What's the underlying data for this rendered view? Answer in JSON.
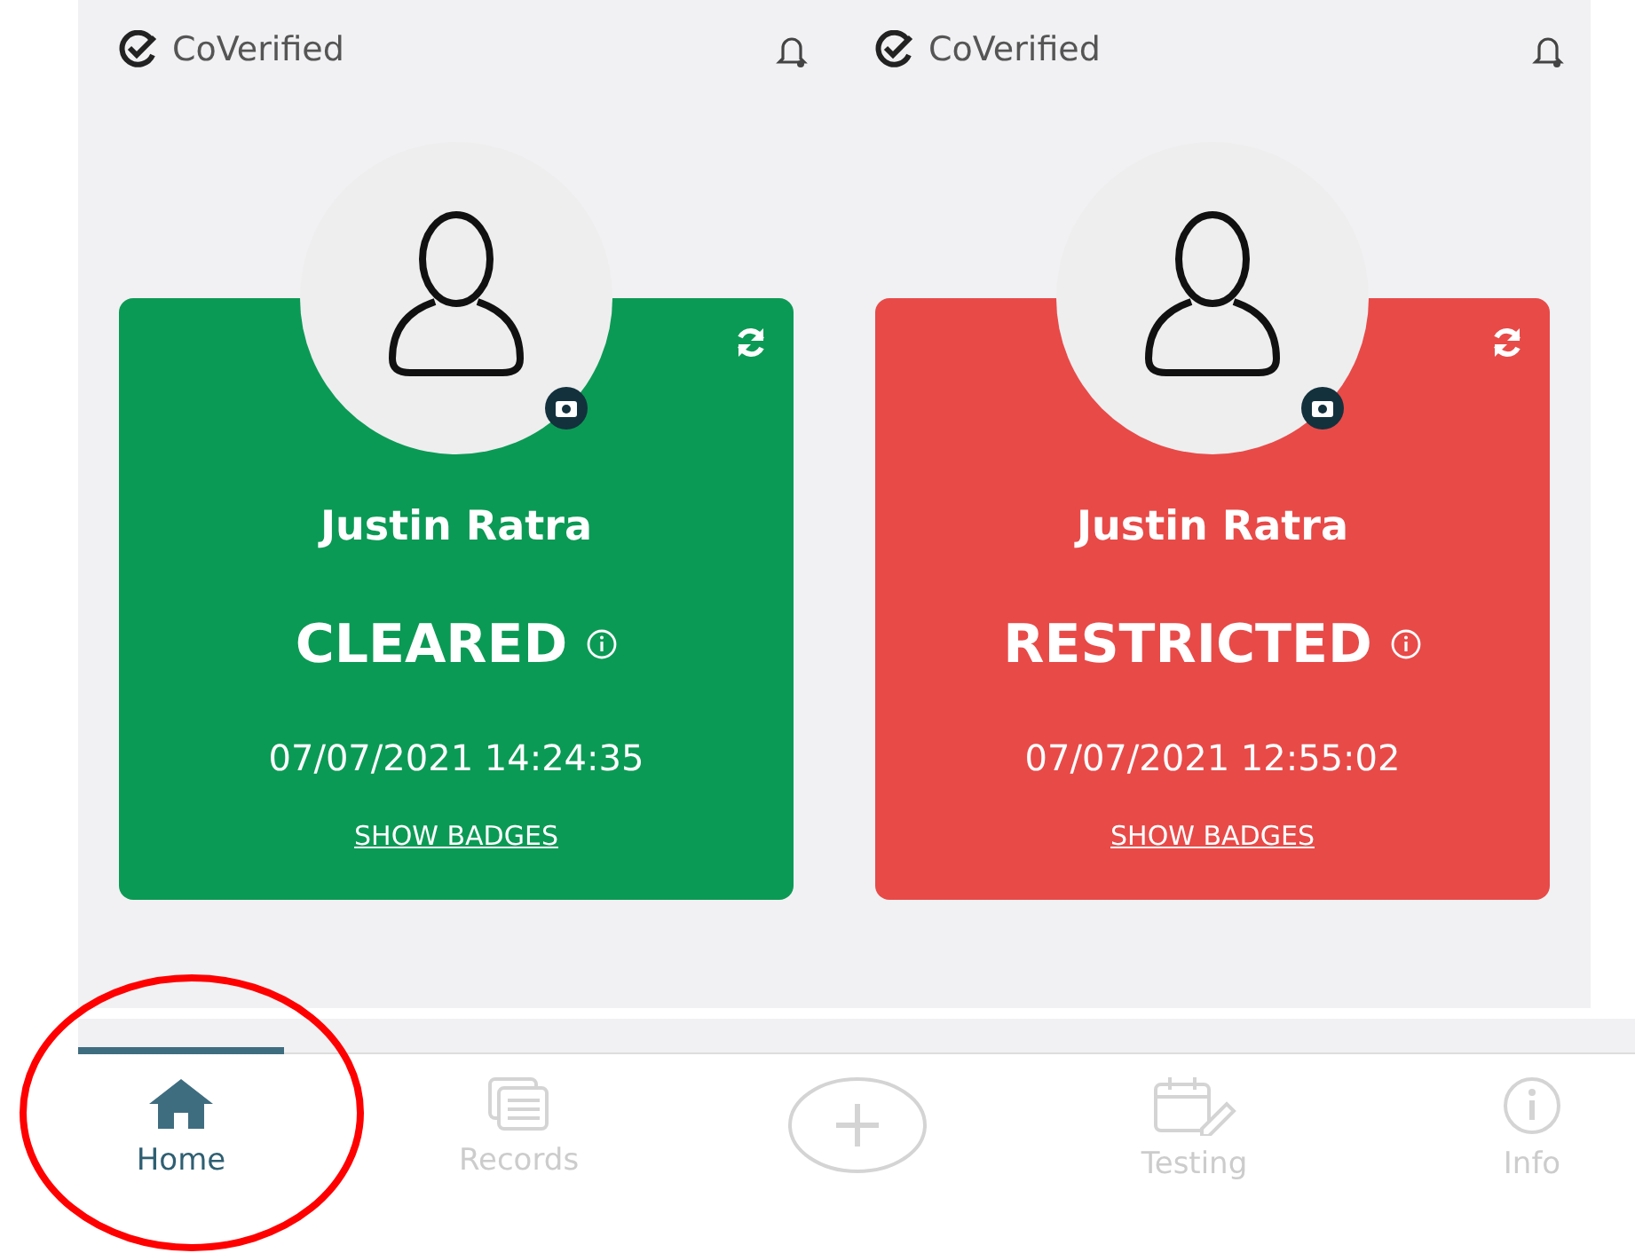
{
  "panels": [
    {
      "brand": "CoVerified",
      "name": "Justin Ratra",
      "status": "CLEARED",
      "timestamp": "07/07/2021 14:24:35",
      "link": "SHOW BADGES",
      "color": "#0b9a55"
    },
    {
      "brand": "CoVerified",
      "name": "Justin Ratra",
      "status": "RESTRICTED",
      "timestamp": "07/07/2021 12:55:02",
      "link": "SHOW BADGES",
      "color": "#e84a48"
    }
  ],
  "bottom_nav": [
    {
      "kind": "home",
      "label": "Home",
      "selected": true,
      "circled": true
    },
    {
      "kind": "records",
      "label": "Records",
      "selected": false,
      "circled": false
    },
    {
      "kind": "add",
      "selected": false,
      "circled": false
    },
    {
      "kind": "testing",
      "label": "Testing",
      "selected": false,
      "circled": false
    },
    {
      "kind": "info",
      "label": "Info",
      "selected": false,
      "circled": false
    }
  ]
}
